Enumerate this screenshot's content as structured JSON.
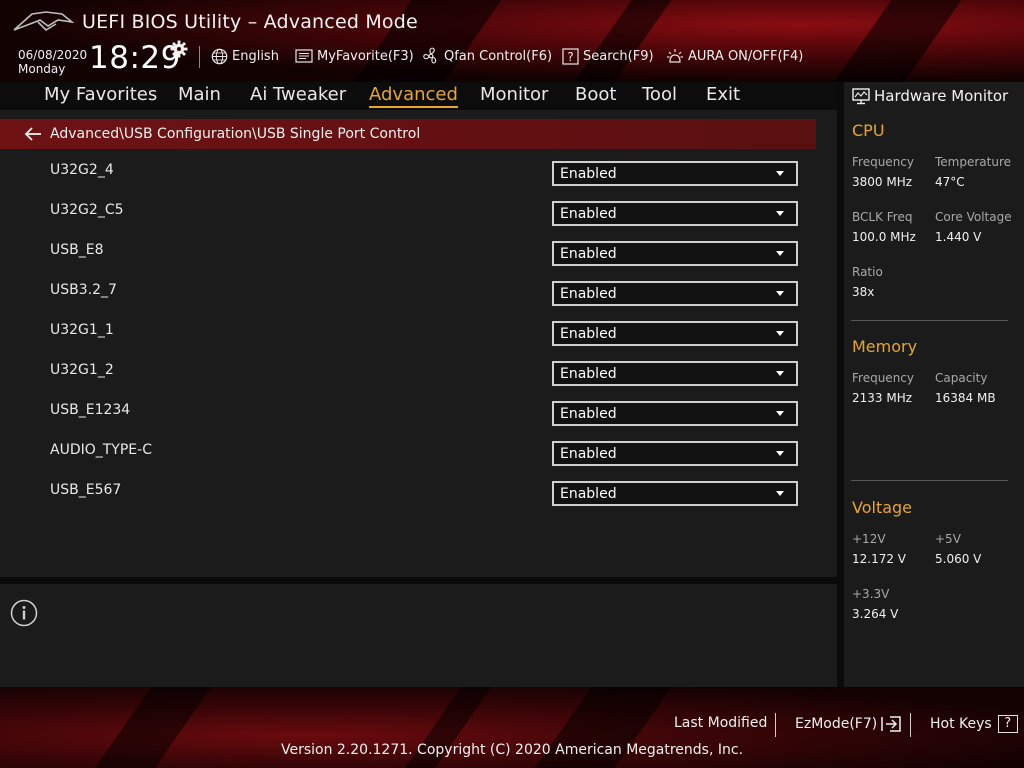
{
  "header": {
    "app_title": "UEFI BIOS Utility – Advanced Mode",
    "date": "06/08/2020",
    "day": "Monday",
    "time": "18:29",
    "language": "English",
    "myfavorite": "MyFavorite(F3)",
    "qfan": "Qfan Control(F6)",
    "search": "Search(F9)",
    "aura": "AURA ON/OFF(F4)"
  },
  "menu": {
    "items": [
      "My Favorites",
      "Main",
      "Ai Tweaker",
      "Advanced",
      "Monitor",
      "Boot",
      "Tool",
      "Exit"
    ],
    "active": "Advanced"
  },
  "breadcrumb": "Advanced\\USB Configuration\\USB Single Port Control",
  "settings": [
    {
      "label": "U32G2_4",
      "value": "Enabled"
    },
    {
      "label": "U32G2_C5",
      "value": "Enabled"
    },
    {
      "label": "USB_E8",
      "value": "Enabled"
    },
    {
      "label": "USB3.2_7",
      "value": "Enabled"
    },
    {
      "label": "U32G1_1",
      "value": "Enabled"
    },
    {
      "label": "U32G1_2",
      "value": "Enabled"
    },
    {
      "label": "USB_E1234",
      "value": "Enabled"
    },
    {
      "label": "AUDIO_TYPE-C",
      "value": "Enabled"
    },
    {
      "label": "USB_E567",
      "value": "Enabled"
    }
  ],
  "hw_monitor": {
    "title": "Hardware Monitor",
    "cpu": {
      "title": "CPU",
      "frequency_label": "Frequency",
      "frequency": "3800 MHz",
      "temperature_label": "Temperature",
      "temperature": "47°C",
      "bclk_label": "BCLK Freq",
      "bclk": "100.0 MHz",
      "core_voltage_label": "Core Voltage",
      "core_voltage": "1.440 V",
      "ratio_label": "Ratio",
      "ratio": "38x"
    },
    "memory": {
      "title": "Memory",
      "frequency_label": "Frequency",
      "frequency": "2133 MHz",
      "capacity_label": "Capacity",
      "capacity": "16384 MB"
    },
    "voltage": {
      "title": "Voltage",
      "v12_label": "+12V",
      "v12": "12.172 V",
      "v5_label": "+5V",
      "v5": "5.060 V",
      "v33_label": "+3.3V",
      "v33": "3.264 V"
    }
  },
  "footer": {
    "last_modified": "Last Modified",
    "ezmode": "EzMode(F7)",
    "hotkeys": "Hot Keys",
    "hotkeys_key": "?",
    "copyright": "Version 2.20.1271. Copyright (C) 2020 American Megatrends, Inc."
  },
  "colors": {
    "accent": "#e9a52a",
    "breadcrumb_bg": "#6e1214",
    "panel_bg": "#1b1b1b"
  }
}
